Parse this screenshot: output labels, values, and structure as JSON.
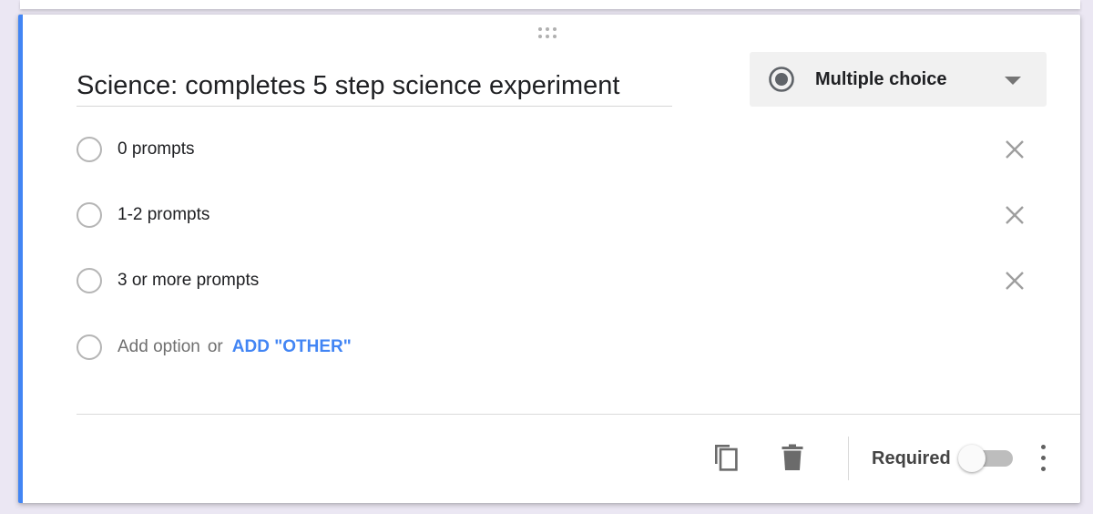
{
  "question": {
    "title": "Science: completes 5 step science experiment"
  },
  "type_select": {
    "label": "Multiple choice",
    "icon": "radio-button-checked-icon"
  },
  "options": [
    {
      "label": "0 prompts"
    },
    {
      "label": "1-2 prompts"
    },
    {
      "label": "3 or more prompts"
    }
  ],
  "add_option": {
    "label": "Add option",
    "or": "or",
    "add_other": "ADD \"OTHER\""
  },
  "footer": {
    "required_label": "Required",
    "required_on": false
  },
  "colors": {
    "accent": "#4285f4",
    "background": "#ebe7f3"
  }
}
